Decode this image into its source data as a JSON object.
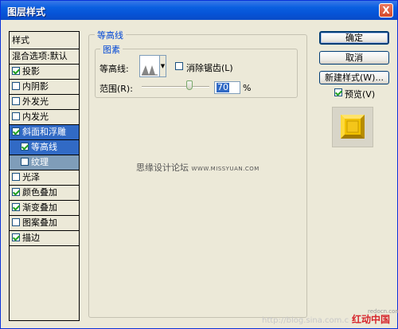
{
  "window": {
    "title": "图层样式",
    "close_glyph": "X"
  },
  "style_list": {
    "header": "样式",
    "items": [
      {
        "label": "混合选项:默认",
        "checkbox": false,
        "checked": false
      },
      {
        "label": "投影",
        "checkbox": true,
        "checked": true
      },
      {
        "label": "内阴影",
        "checkbox": true,
        "checked": false
      },
      {
        "label": "外发光",
        "checkbox": true,
        "checked": false
      },
      {
        "label": "内发光",
        "checkbox": true,
        "checked": false
      },
      {
        "label": "斜面和浮雕",
        "checkbox": true,
        "checked": true,
        "selected": true
      },
      {
        "label": "等高线",
        "checkbox": true,
        "checked": true,
        "sub": true,
        "active": true
      },
      {
        "label": "纹理",
        "checkbox": true,
        "checked": false,
        "sub": true
      },
      {
        "label": "光泽",
        "checkbox": true,
        "checked": false
      },
      {
        "label": "颜色叠加",
        "checkbox": true,
        "checked": true
      },
      {
        "label": "渐变叠加",
        "checkbox": true,
        "checked": true
      },
      {
        "label": "图案叠加",
        "checkbox": true,
        "checked": false
      },
      {
        "label": "描边",
        "checkbox": true,
        "checked": true
      }
    ]
  },
  "panel": {
    "group_title": "等高线",
    "section_title": "图素",
    "contour_label": "等高线:",
    "anti_alias_label": "消除锯齿(L)",
    "anti_alias_checked": false,
    "range_label": "范围(R):",
    "range_value": "70",
    "range_unit": "%",
    "range_fraction": 0.7
  },
  "buttons": {
    "ok": "确定",
    "cancel": "取消",
    "new_style": "新建样式(W)...",
    "preview_label": "预览(V)",
    "preview_checked": true
  },
  "watermark": {
    "text": "思缘设计论坛",
    "url": "WWW.MISSYUAN.COM"
  },
  "footer": {
    "url": "http://blog.sina.com.c",
    "brand": "红动中国",
    "brand_small": "redocn.com"
  },
  "colors": {
    "title_blue": "#0a5fe0",
    "selection": "#316ac5",
    "preview_gold": "#f2c200"
  }
}
